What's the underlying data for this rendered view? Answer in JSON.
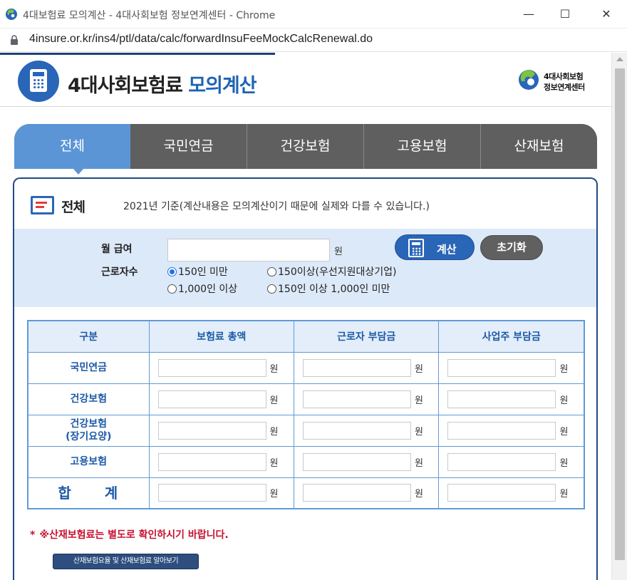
{
  "window": {
    "title": "4대보험료 모의계산 - 4대사회보험 정보연계센터 - Chrome",
    "url": "4insure.or.kr/ins4/ptl/data/calc/forwardInsuFeeMockCalcRenewal.do",
    "controls": {
      "minimize": "—",
      "maximize": "☐",
      "close": "✕"
    }
  },
  "header": {
    "title_main": "4대사회보험료",
    "title_accent": "모의계산",
    "brand_line1": "4대사회보험",
    "brand_line2": "정보연계센터",
    "logo_icon": "calculator-icon"
  },
  "tabs": [
    {
      "label": "전체",
      "active": true
    },
    {
      "label": "국민연금",
      "active": false
    },
    {
      "label": "건강보험",
      "active": false
    },
    {
      "label": "고용보험",
      "active": false
    },
    {
      "label": "산재보험",
      "active": false
    }
  ],
  "section": {
    "title": "전체",
    "note": "2021년 기준(계산내용은 모의계산이기 때문에 실제와 다를 수 있습니다.)"
  },
  "form": {
    "wage_label": "월 급여",
    "wage_value": "",
    "wage_unit": "원",
    "workers_label": "근로자수",
    "options": [
      {
        "label": "150인 미만",
        "checked": true
      },
      {
        "label": "150이상(우선지원대상기업)",
        "checked": false
      },
      {
        "label": "1,000인 이상",
        "checked": false
      },
      {
        "label": "150인 이상 1,000인 미만",
        "checked": false
      }
    ],
    "calc_button": "계산",
    "reset_button": "초기화"
  },
  "table": {
    "headers": [
      "구분",
      "보험료 총액",
      "근로자 부담금",
      "사업주 부담금"
    ],
    "rows": [
      {
        "label": "국민연금",
        "values": [
          "",
          "",
          ""
        ]
      },
      {
        "label": "건강보험",
        "values": [
          "",
          "",
          ""
        ]
      },
      {
        "label": "건강보험\n(장기요양)",
        "label_line1": "건강보험",
        "label_line2": "(장기요양)",
        "values": [
          "",
          "",
          ""
        ]
      },
      {
        "label": "고용보험",
        "values": [
          "",
          "",
          ""
        ]
      },
      {
        "label": "합 계",
        "values": [
          "",
          "",
          ""
        ]
      }
    ],
    "unit": "원"
  },
  "notice": {
    "star": "*",
    "text": "※산재보험료는 별도로 확인하시기 바랍니다.",
    "link_button": "산재보험요율 및 산재보험료 알아보기"
  },
  "colors": {
    "primary": "#2a66b8",
    "tab_active": "#5b95d6",
    "tab_inactive": "#5f5f5f",
    "panel_bg": "#dce9f8",
    "warning": "#c8102e"
  }
}
